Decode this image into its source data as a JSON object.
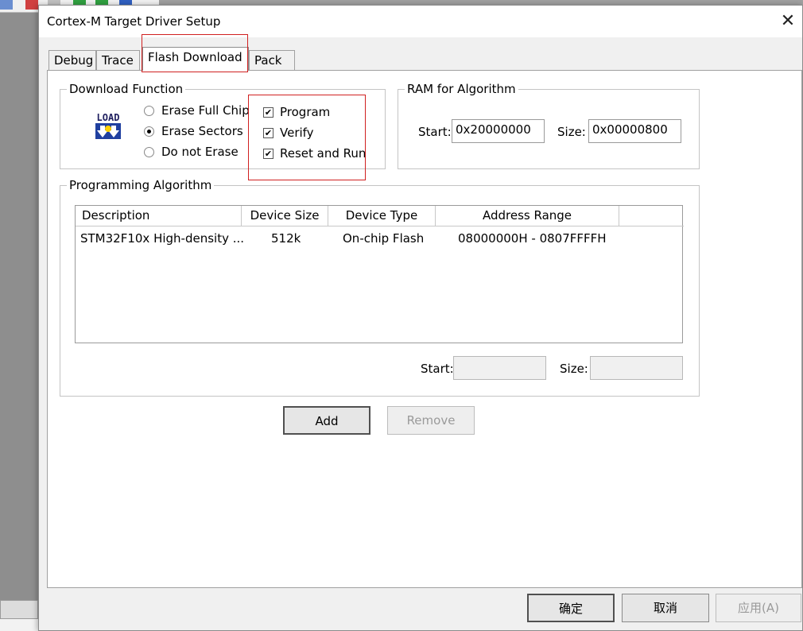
{
  "window": {
    "title": "Cortex-M Target Driver Setup"
  },
  "tabs": [
    {
      "label": "Debug"
    },
    {
      "label": "Trace"
    },
    {
      "label": "Flash Download"
    },
    {
      "label": "Pack"
    }
  ],
  "download_function": {
    "legend": "Download Function",
    "icon_text": "LOAD",
    "erase_options": [
      {
        "label": "Erase Full Chip",
        "selected": false
      },
      {
        "label": "Erase Sectors",
        "selected": true
      },
      {
        "label": "Do not Erase",
        "selected": false
      }
    ],
    "checks": [
      {
        "label": "Program",
        "checked": true
      },
      {
        "label": "Verify",
        "checked": true
      },
      {
        "label": "Reset and Run",
        "checked": true
      }
    ],
    "check_mark": "✔"
  },
  "ram": {
    "legend": "RAM for Algorithm",
    "start_label": "Start:",
    "start_value": "0x20000000",
    "size_label": "Size:",
    "size_value": "0x00000800"
  },
  "algorithm": {
    "legend": "Programming Algorithm",
    "columns": [
      "Description",
      "Device Size",
      "Device Type",
      "Address Range"
    ],
    "rows": [
      {
        "description": "STM32F10x High-density ...",
        "device_size": "512k",
        "device_type": "On-chip Flash",
        "address_range": "08000000H - 0807FFFFH"
      }
    ],
    "start_label": "Start:",
    "start_value": "",
    "size_label": "Size:",
    "size_value": ""
  },
  "buttons": {
    "add": "Add",
    "remove": "Remove",
    "ok": "确定",
    "cancel": "取消",
    "apply": "应用(A)"
  },
  "close_glyph": "✕"
}
